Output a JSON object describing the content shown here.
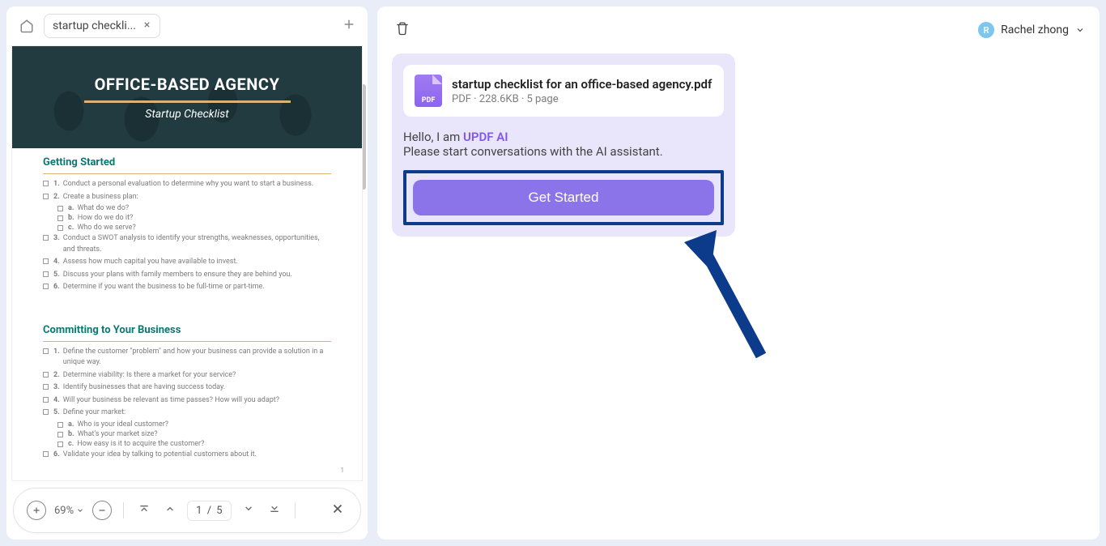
{
  "tab": {
    "label": "startup checkli..."
  },
  "document": {
    "hero_title": "OFFICE-BASED AGENCY",
    "hero_sub": "Startup Checklist",
    "sections": {
      "getting_started": {
        "title": "Getting Started",
        "items": [
          {
            "n": "1.",
            "text": "Conduct a personal evaluation to determine why you want to start a business."
          },
          {
            "n": "2.",
            "text": "Create a business plan:",
            "subs": [
              {
                "l": "a.",
                "text": "What do we do?"
              },
              {
                "l": "b.",
                "text": "How do we do it?"
              },
              {
                "l": "c.",
                "text": "Who do we serve?"
              }
            ]
          },
          {
            "n": "3.",
            "text": "Conduct a SWOT analysis to identify your strengths, weaknesses, opportunities, and threats."
          },
          {
            "n": "4.",
            "text": "Assess how much capital you have available to invest."
          },
          {
            "n": "5.",
            "text": "Discuss your plans with family members to ensure they are behind you."
          },
          {
            "n": "6.",
            "text": "Determine if you want the business to be full-time or part-time."
          }
        ]
      },
      "committing": {
        "title": "Committing to Your Business",
        "items": [
          {
            "n": "1.",
            "text": "Define the customer \"problem\" and how your business can provide a solution in a unique way."
          },
          {
            "n": "2.",
            "text": "Determine viability: Is there a market for your service?"
          },
          {
            "n": "3.",
            "text": "Identify businesses that are having success today."
          },
          {
            "n": "4.",
            "text": "Will your business be relevant as time passes? How will you adapt?"
          },
          {
            "n": "5.",
            "text": "Define your market:",
            "subs": [
              {
                "l": "a.",
                "text": "Who is your ideal customer?"
              },
              {
                "l": "b.",
                "text": "What's your market size?"
              },
              {
                "l": "c.",
                "text": "How easy is it to acquire the customer?"
              }
            ]
          },
          {
            "n": "6.",
            "text": "Validate your idea by talking to potential customers about it."
          }
        ]
      }
    },
    "page_num_tiny": "1"
  },
  "toolbar": {
    "zoom_readout": "69%",
    "page_current": "1",
    "page_sep": "/",
    "page_total": "5"
  },
  "right": {
    "user_name": "Rachel zhong",
    "user_initial": "R",
    "file_name": "startup checklist for an office-based agency.pdf",
    "file_meta": "PDF · 228.6KB · 5 page",
    "greet_prefix": "Hello, I am ",
    "greet_brand": "UPDF AI",
    "greet_line2": "Please start conversations with the AI assistant.",
    "get_started": "Get Started",
    "pdf_badge_text": "PDF"
  }
}
